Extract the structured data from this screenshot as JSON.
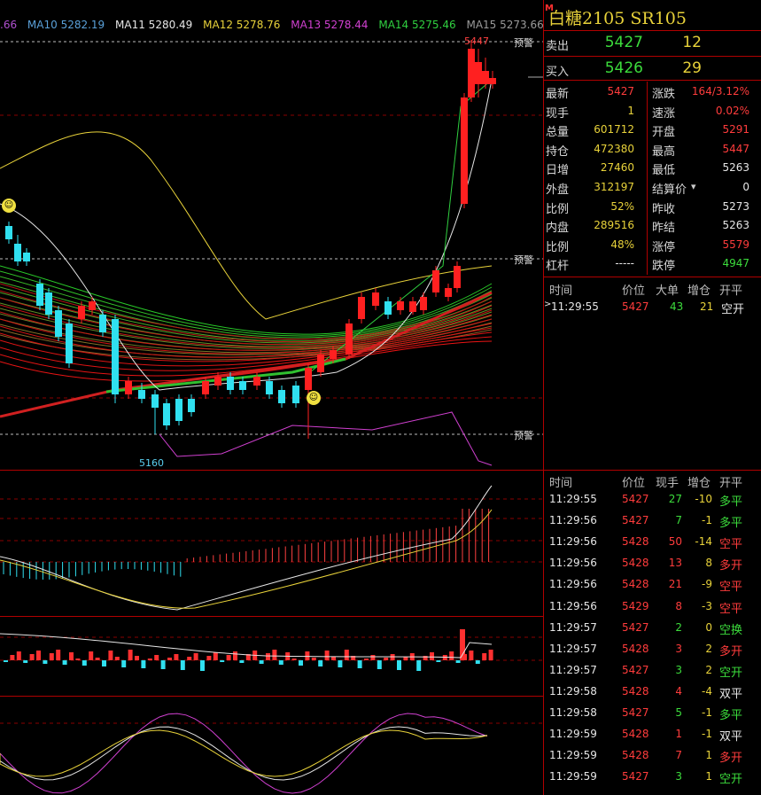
{
  "ma_legend": [
    {
      "label": ".66",
      "color": "#b050d0"
    },
    {
      "label": "MA10 5282.19",
      "color": "#5aa0d8"
    },
    {
      "label": "MA11 5280.49",
      "color": "#e6e6e6"
    },
    {
      "label": "MA12 5278.76",
      "color": "#e8d23a"
    },
    {
      "label": "MA13 5278.44",
      "color": "#d040d0"
    },
    {
      "label": "MA14 5275.46",
      "color": "#30d040"
    },
    {
      "label": "MA15 5273.66",
      "color": "#9a9a9a"
    }
  ],
  "chart_labels": {
    "high": "5447",
    "low": "5160",
    "warn": "预警"
  },
  "header": {
    "badge": "M",
    "title": "白糖2105  SR105"
  },
  "orderbook": {
    "ask_label": "卖出",
    "ask_price": "5427",
    "ask_qty": "12",
    "bid_label": "买入",
    "bid_price": "5426",
    "bid_qty": "29"
  },
  "stats": [
    {
      "l1": "最新",
      "v1": "5427",
      "c1": "red",
      "l2": "涨跌",
      "v2": "164/3.12%",
      "c2": "red"
    },
    {
      "l1": "现手",
      "v1": "1",
      "c1": "yel",
      "l2": "速涨",
      "v2": "0.02%",
      "c2": "red"
    },
    {
      "l1": "总量",
      "v1": "601712",
      "c1": "yel",
      "l2": "开盘",
      "v2": "5291",
      "c2": "red"
    },
    {
      "l1": "持仓",
      "v1": "472380",
      "c1": "yel",
      "l2": "最高",
      "v2": "5447",
      "c2": "red"
    },
    {
      "l1": "日增",
      "v1": "27460",
      "c1": "yel",
      "l2": "最低",
      "v2": "5263",
      "c2": "wht"
    },
    {
      "l1": "外盘",
      "v1": "312197",
      "c1": "yel",
      "l2": "结算价",
      "v2": "0",
      "c2": "wht"
    },
    {
      "l1": "比例",
      "v1": "52%",
      "c1": "yel",
      "l2": "昨收",
      "v2": "5273",
      "c2": "wht"
    },
    {
      "l1": "内盘",
      "v1": "289516",
      "c1": "yel",
      "l2": "昨结",
      "v2": "5263",
      "c2": "wht"
    },
    {
      "l1": "比例",
      "v1": "48%",
      "c1": "yel",
      "l2": "涨停",
      "v2": "5579",
      "c2": "red"
    },
    {
      "l1": "杠杆",
      "v1": "-----",
      "c1": "wht",
      "l2": "跌停",
      "v2": "4947",
      "c2": "grn"
    }
  ],
  "big_table": {
    "headers": [
      "时间",
      "价位",
      "大单",
      "增仓",
      "开平"
    ],
    "rows": [
      {
        "time": "11:29:55",
        "price": "5427",
        "size": "43",
        "oi": "21",
        "type": "空开"
      }
    ]
  },
  "tick_table": {
    "headers": [
      "时间",
      "价位",
      "现手",
      "增仓",
      "开平"
    ],
    "rows": [
      {
        "time": "11:29:55",
        "price": "5427",
        "qty": "27",
        "qc": "grn",
        "oi": "-10",
        "type": "多平",
        "tc": "grn"
      },
      {
        "time": "11:29:56",
        "price": "5427",
        "qty": "7",
        "qc": "grn",
        "oi": "-1",
        "type": "多平",
        "tc": "grn"
      },
      {
        "time": "11:29:56",
        "price": "5428",
        "qty": "50",
        "qc": "red",
        "oi": "-14",
        "type": "空平",
        "tc": "red"
      },
      {
        "time": "11:29:56",
        "price": "5428",
        "qty": "13",
        "qc": "red",
        "oi": "8",
        "type": "多开",
        "tc": "red"
      },
      {
        "time": "11:29:56",
        "price": "5428",
        "qty": "21",
        "qc": "red",
        "oi": "-9",
        "type": "空平",
        "tc": "red"
      },
      {
        "time": "11:29:56",
        "price": "5429",
        "qty": "8",
        "qc": "red",
        "oi": "-3",
        "type": "空平",
        "tc": "red"
      },
      {
        "time": "11:29:57",
        "price": "5427",
        "qty": "2",
        "qc": "grn",
        "oi": "0",
        "type": "空换",
        "tc": "grn"
      },
      {
        "time": "11:29:57",
        "price": "5428",
        "qty": "3",
        "qc": "red",
        "oi": "2",
        "type": "多开",
        "tc": "red"
      },
      {
        "time": "11:29:57",
        "price": "5427",
        "qty": "3",
        "qc": "grn",
        "oi": "2",
        "type": "空开",
        "tc": "grn"
      },
      {
        "time": "11:29:58",
        "price": "5428",
        "qty": "4",
        "qc": "red",
        "oi": "-4",
        "type": "双平",
        "tc": "wht"
      },
      {
        "time": "11:29:58",
        "price": "5427",
        "qty": "5",
        "qc": "grn",
        "oi": "-1",
        "type": "多平",
        "tc": "grn"
      },
      {
        "time": "11:29:59",
        "price": "5428",
        "qty": "1",
        "qc": "red",
        "oi": "-1",
        "type": "双平",
        "tc": "wht"
      },
      {
        "time": "11:29:59",
        "price": "5428",
        "qty": "7",
        "qc": "red",
        "oi": "1",
        "type": "多开",
        "tc": "red"
      },
      {
        "time": "11:29:59",
        "price": "5427",
        "qty": "3",
        "qc": "grn",
        "oi": "1",
        "type": "空开",
        "tc": "grn"
      }
    ]
  }
}
